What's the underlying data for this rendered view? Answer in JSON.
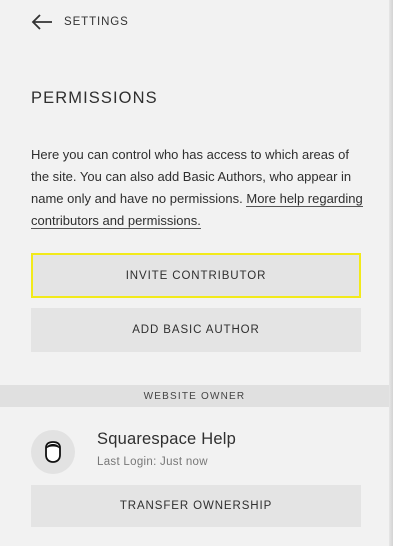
{
  "header": {
    "back_label": "SETTINGS",
    "back_icon": "arrow-left-icon"
  },
  "page": {
    "title": "PERMISSIONS",
    "description": "Here you can control who has access to which areas of the site. You can also add Basic Authors, who appear in name only and have no permissions.",
    "help_link": "More help regarding contributors and permissions."
  },
  "actions": {
    "invite_label": "INVITE CONTRIBUTOR",
    "add_author_label": "ADD BASIC AUTHOR"
  },
  "owner_section": {
    "heading": "WEBSITE OWNER",
    "name": "Squarespace Help",
    "last_login": "Last Login: Just now",
    "avatar_icon": "user-avatar-icon",
    "transfer_label": "TRANSFER OWNERSHIP"
  },
  "colors": {
    "background": "#f2f2f2",
    "button": "#e4e4e4",
    "highlight": "#f2ea1a",
    "section_bar": "#e0e0e0"
  }
}
